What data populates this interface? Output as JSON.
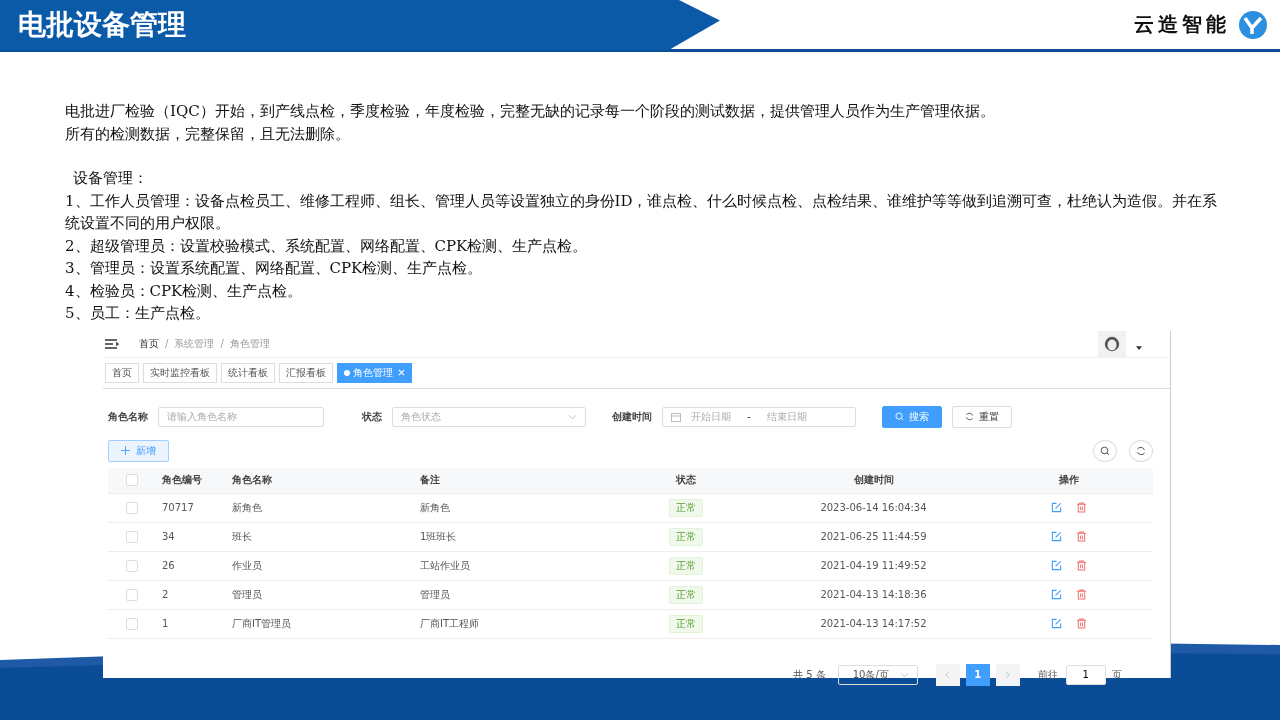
{
  "header": {
    "title": "电批设备管理",
    "logo_text": "云造智能"
  },
  "intro": [
    "电批进厂检验（IQC）开始，到产线点检，季度检验，年度检验，完整无缺的记录每一个阶段的测试数据，提供管理人员作为生产管理依据。",
    "所有的检测数据，完整保留，且无法删除。"
  ],
  "section_title": "设备管理：",
  "items": [
    "1、工作人员管理：设备点检员工、维修工程师、组长、管理人员等设置独立的身份ID，谁点检、什么时候点检、点检结果、谁维护等等做到追溯可查，杜绝认为造假。并在系统设置不同的用户权限。",
    "2、超级管理员：设置校验模式、系统配置、网络配置、CPK检测、生产点检。",
    "3、管理员：设置系统配置、网络配置、CPK检测、生产点检。",
    "4、检验员：CPK检测、生产点检。",
    "5、员工：生产点检。"
  ],
  "app": {
    "breadcrumb": [
      "首页",
      "系统管理",
      "角色管理"
    ],
    "breadcrumb_separator": "/",
    "tabs": [
      {
        "label": "首页",
        "selected": false
      },
      {
        "label": "实时监控看板",
        "selected": false
      },
      {
        "label": "统计看板",
        "selected": false
      },
      {
        "label": "汇报看板",
        "selected": false
      },
      {
        "label": "角色管理",
        "selected": true
      }
    ],
    "filters": {
      "name_label": "角色名称",
      "name_placeholder": "请输入角色名称",
      "status_label": "状态",
      "status_placeholder": "角色状态",
      "time_label": "创建时间",
      "start_placeholder": "开始日期",
      "range_separator": "-",
      "end_placeholder": "结束日期",
      "search_button": "搜索",
      "reset_button": "重置"
    },
    "add_button": "新增",
    "table": {
      "columns": [
        "角色编号",
        "角色名称",
        "备注",
        "状态",
        "创建时间",
        "操作"
      ],
      "all_checked": false,
      "rows": [
        {
          "checked": false,
          "id": "70717",
          "name": "新角色",
          "remark": "新角色",
          "status": "正常",
          "created": "2023-06-14 16:04:34"
        },
        {
          "checked": false,
          "id": "34",
          "name": "班长",
          "remark": "1班班长",
          "status": "正常",
          "created": "2021-06-25 11:44:59"
        },
        {
          "checked": false,
          "id": "26",
          "name": "作业员",
          "remark": "工站作业员",
          "status": "正常",
          "created": "2021-04-19 11:49:52"
        },
        {
          "checked": false,
          "id": "2",
          "name": "管理员",
          "remark": "管理员",
          "status": "正常",
          "created": "2021-04-13 14:18:36"
        },
        {
          "checked": false,
          "id": "1",
          "name": "厂商IT管理员",
          "remark": "厂商IT工程师",
          "status": "正常",
          "created": "2021-04-13 14:17:52"
        }
      ]
    },
    "pagination": {
      "total": "共 5 条",
      "page_size": "10条/页",
      "pages": [
        {
          "label": "1",
          "selected": true
        }
      ],
      "goto_label": "前往",
      "goto_value": "1",
      "goto_unit": "页"
    }
  }
}
